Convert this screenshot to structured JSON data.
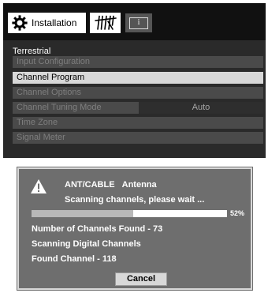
{
  "header": {
    "installation_label": "Installation",
    "info_label": "i"
  },
  "menu": {
    "section_title": "Terrestrial",
    "items": [
      {
        "label": "Input Configuration",
        "state": "disabled"
      },
      {
        "label": "Channel Program",
        "state": "selected"
      },
      {
        "label": "Channel Options",
        "state": "disabled"
      },
      {
        "label": "Channel Tuning Mode",
        "state": "disabled",
        "value": "Auto"
      },
      {
        "label": "Time Zone",
        "state": "disabled"
      },
      {
        "label": "Signal Meter",
        "state": "disabled"
      }
    ]
  },
  "dialog": {
    "source": "ANT/CABLE",
    "input": "Antenna",
    "status": "Scanning channels, please wait ...",
    "progress_percent": 52,
    "progress_label": "52%",
    "channels_found": "Number of Channels Found - 73",
    "scan_type": "Scanning Digital Channels",
    "found_channel": "Found Channel - 118",
    "cancel_label": "Cancel"
  },
  "colors": {
    "menu_background": "#2a2a2a",
    "selected_row": "#d8d8d8",
    "dialog_background": "#6e6e6e",
    "progress_fill": "#b8b8b8"
  },
  "icons": [
    "gear-icon",
    "antenna-icon",
    "info-icon",
    "warning-icon"
  ]
}
